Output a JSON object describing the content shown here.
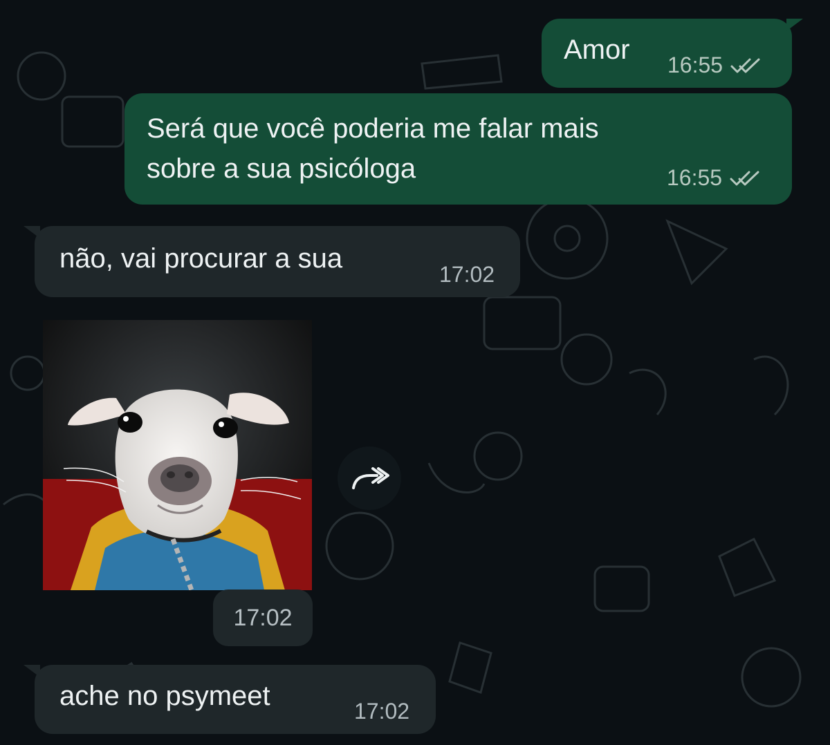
{
  "messages": [
    {
      "direction": "outgoing",
      "text": "Amor",
      "time": "16:55",
      "status_icon": "double-check-icon"
    },
    {
      "direction": "outgoing",
      "text_lines": [
        "Será que você poderia me falar mais",
        "sobre a sua psicóloga"
      ],
      "time": "16:55",
      "status_icon": "double-check-icon"
    },
    {
      "direction": "incoming",
      "text": "não, vai procurar a sua",
      "time": "17:02"
    },
    {
      "direction": "incoming",
      "type": "image",
      "image_description": "white puppy photo",
      "time": "17:02",
      "action_icon": "forward-icon"
    },
    {
      "direction": "incoming",
      "text": "ache no psymeet",
      "time": "17:02"
    }
  ],
  "colors": {
    "background": "#0b1014",
    "outgoing_bubble": "#144d37",
    "incoming_bubble": "#1f272a",
    "text": "#e9edef",
    "meta_text": "#b2bcc0"
  }
}
